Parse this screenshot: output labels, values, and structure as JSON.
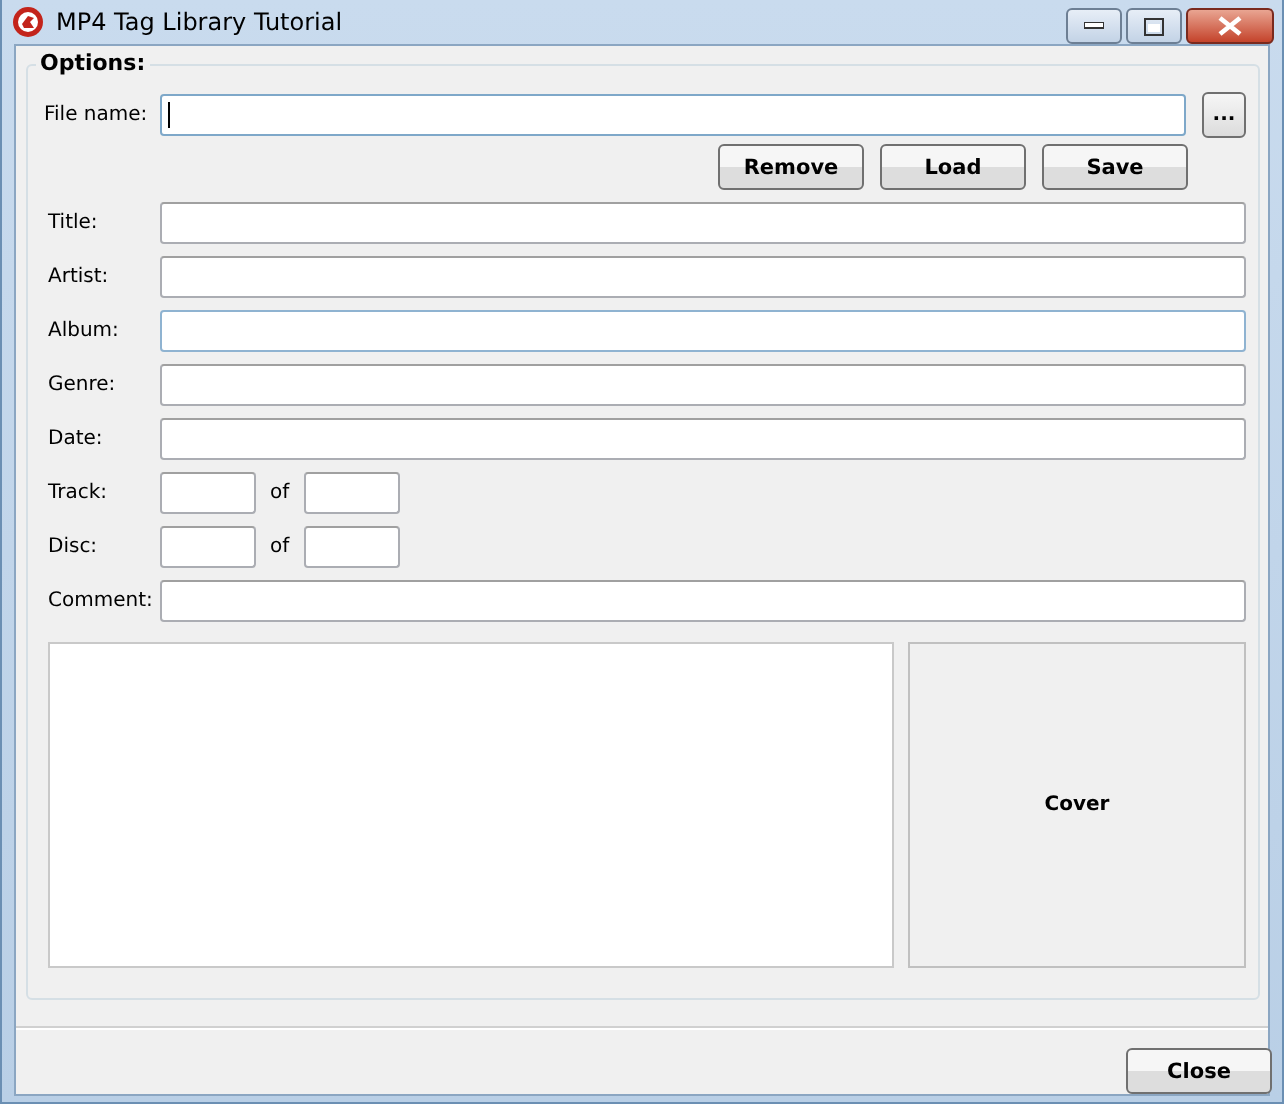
{
  "window": {
    "title": "MP4 Tag Library Tutorial"
  },
  "group": {
    "title": "Options:"
  },
  "file": {
    "label": "File name:",
    "focused": true,
    "browse": "..."
  },
  "actions": [
    "Remove",
    "Load",
    "Save"
  ],
  "fields": [
    {
      "kind": "text",
      "label": "Title:",
      "hovered": false
    },
    {
      "kind": "text",
      "label": "Artist:",
      "hovered": false
    },
    {
      "kind": "text",
      "label": "Album:",
      "hovered": true
    },
    {
      "kind": "text",
      "label": "Genre:",
      "hovered": false
    },
    {
      "kind": "text",
      "label": "Date:",
      "hovered": false
    },
    {
      "kind": "pair",
      "label": "Track:",
      "of": "of",
      "hovered": false
    },
    {
      "kind": "pair",
      "label": "Disc:",
      "of": "of",
      "hovered": false
    },
    {
      "kind": "text",
      "label": "Comment:",
      "hovered": false
    }
  ],
  "cover": {
    "label": "Cover"
  },
  "close_button": "Close"
}
